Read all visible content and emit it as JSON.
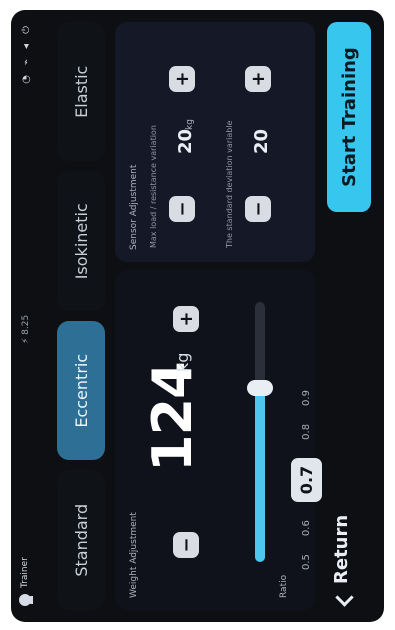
{
  "statusbar": {
    "user_name": "Trainer",
    "center_text": "⚡ 8.25",
    "icons": [
      "alarm-icon",
      "wifi-icon",
      "signal-icon",
      "power-icon"
    ]
  },
  "tabs": [
    {
      "label": "Standard",
      "active": false
    },
    {
      "label": "Eccentric",
      "active": true
    },
    {
      "label": "Isokinetic",
      "active": false
    },
    {
      "label": "Elastic",
      "active": false
    }
  ],
  "weight": {
    "label": "Weight Adjustment",
    "value": "124",
    "unit": "kg",
    "slider_level": 0.67
  },
  "ratio": {
    "label": "Ratio",
    "options": [
      "0.5",
      "0.6",
      "0.7",
      "0.8",
      "0.9"
    ],
    "selected": "0.7"
  },
  "sensor": {
    "label": "Sensor Adjustment",
    "rows": [
      {
        "desc": "Max load / resistance variation",
        "value": "20",
        "unit": "kg"
      },
      {
        "desc": "The standard deviation variable",
        "value": "20",
        "unit": ""
      }
    ]
  },
  "actions": {
    "return_label": "Return",
    "start_label": "Start Training"
  },
  "colors": {
    "accent": "#37c6ee",
    "active_tab": "#2d6f95",
    "background": "#0e0f12"
  }
}
